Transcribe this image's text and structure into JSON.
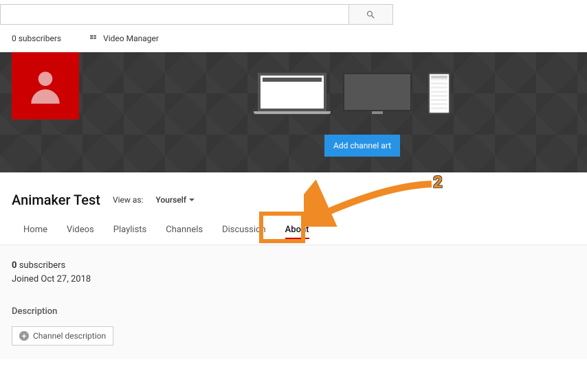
{
  "search": {
    "placeholder": ""
  },
  "topbar": {
    "subscribers": "0 subscribers",
    "video_manager": "Video Manager"
  },
  "banner": {
    "add_art": "Add channel art"
  },
  "channel": {
    "name": "Animaker Test",
    "view_as_label": "View as:",
    "view_as_value": "Yourself"
  },
  "tabs": [
    {
      "label": "Home"
    },
    {
      "label": "Videos"
    },
    {
      "label": "Playlists"
    },
    {
      "label": "Channels"
    },
    {
      "label": "Discussion"
    },
    {
      "label": "About"
    }
  ],
  "about": {
    "subs_count": "0",
    "subs_label": "subscribers",
    "joined": "Joined Oct 27, 2018",
    "description_heading": "Description",
    "channel_desc_btn": "Channel description"
  },
  "annotation": {
    "step": "2"
  }
}
